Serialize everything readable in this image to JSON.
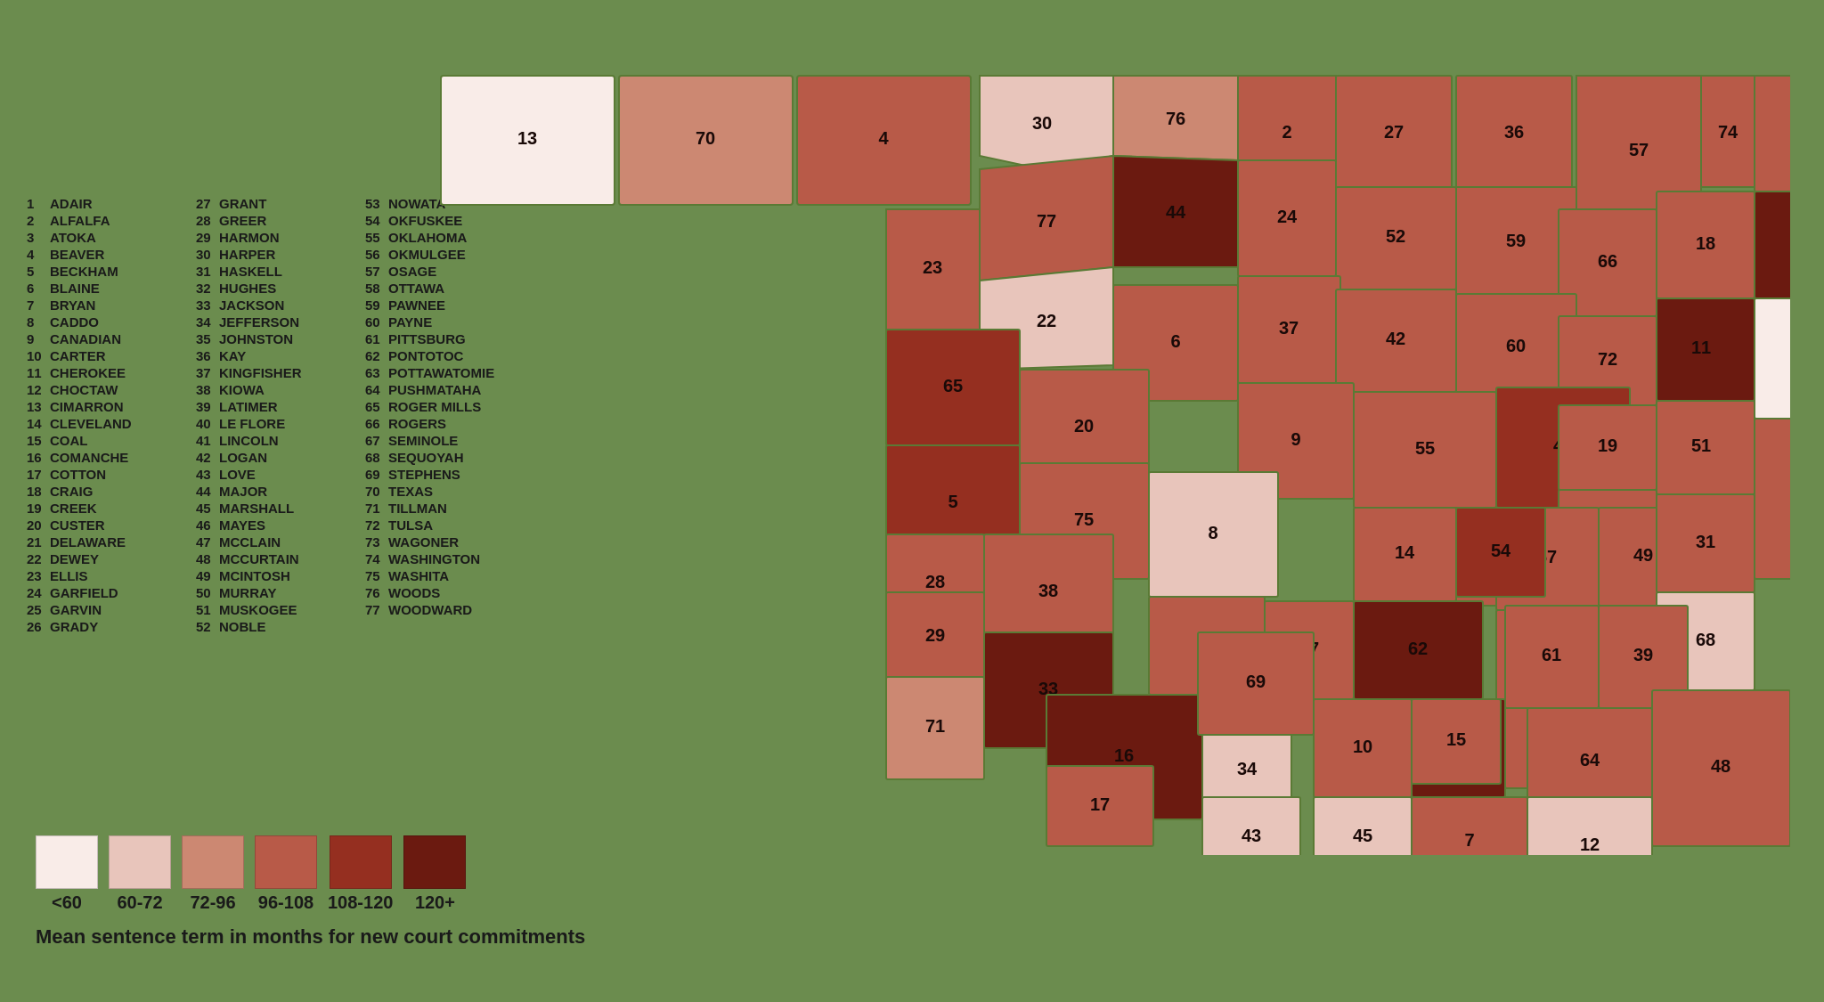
{
  "title": "Mean sentence term in months for new court commitments",
  "legend": {
    "items": [
      {
        "label": "<60",
        "color": "#f9ece8"
      },
      {
        "label": "60-72",
        "color": "#e8c5bb"
      },
      {
        "label": "72-96",
        "color": "#cc8872"
      },
      {
        "label": "96-108",
        "color": "#b85a48"
      },
      {
        "label": "108-120",
        "color": "#952f20"
      },
      {
        "label": "120+",
        "color": "#6b1a10"
      }
    ]
  },
  "counties": [
    {
      "num": 1,
      "name": "ADAIR"
    },
    {
      "num": 2,
      "name": "ALFALFA"
    },
    {
      "num": 3,
      "name": "ATOKA"
    },
    {
      "num": 4,
      "name": "BEAVER"
    },
    {
      "num": 5,
      "name": "BECKHAM"
    },
    {
      "num": 6,
      "name": "BLAINE"
    },
    {
      "num": 7,
      "name": "BRYAN"
    },
    {
      "num": 8,
      "name": "CADDO"
    },
    {
      "num": 9,
      "name": "CANADIAN"
    },
    {
      "num": 10,
      "name": "CARTER"
    },
    {
      "num": 11,
      "name": "CHEROKEE"
    },
    {
      "num": 12,
      "name": "CHOCTAW"
    },
    {
      "num": 13,
      "name": "CIMARRON"
    },
    {
      "num": 14,
      "name": "CLEVELAND"
    },
    {
      "num": 15,
      "name": "COAL"
    },
    {
      "num": 16,
      "name": "COMANCHE"
    },
    {
      "num": 17,
      "name": "COTTON"
    },
    {
      "num": 18,
      "name": "CRAIG"
    },
    {
      "num": 19,
      "name": "CREEK"
    },
    {
      "num": 20,
      "name": "CUSTER"
    },
    {
      "num": 21,
      "name": "DELAWARE"
    },
    {
      "num": 22,
      "name": "DEWEY"
    },
    {
      "num": 23,
      "name": "ELLIS"
    },
    {
      "num": 24,
      "name": "GARFIELD"
    },
    {
      "num": 25,
      "name": "GARVIN"
    },
    {
      "num": 26,
      "name": "GRADY"
    },
    {
      "num": 27,
      "name": "GRANT"
    },
    {
      "num": 28,
      "name": "GREER"
    },
    {
      "num": 29,
      "name": "HARMON"
    },
    {
      "num": 30,
      "name": "HARPER"
    },
    {
      "num": 31,
      "name": "HASKELL"
    },
    {
      "num": 32,
      "name": "HUGHES"
    },
    {
      "num": 33,
      "name": "JACKSON"
    },
    {
      "num": 34,
      "name": "JEFFERSON"
    },
    {
      "num": 35,
      "name": "JOHNSTON"
    },
    {
      "num": 36,
      "name": "KAY"
    },
    {
      "num": 37,
      "name": "KINGFISHER"
    },
    {
      "num": 38,
      "name": "KIOWA"
    },
    {
      "num": 39,
      "name": "LATIMER"
    },
    {
      "num": 40,
      "name": "LE FLORE"
    },
    {
      "num": 41,
      "name": "LINCOLN"
    },
    {
      "num": 42,
      "name": "LOGAN"
    },
    {
      "num": 43,
      "name": "LOVE"
    },
    {
      "num": 44,
      "name": "MAJOR"
    },
    {
      "num": 45,
      "name": "MARSHALL"
    },
    {
      "num": 46,
      "name": "MAYES"
    },
    {
      "num": 47,
      "name": "MCCLAIN"
    },
    {
      "num": 48,
      "name": "MCCURTAIN"
    },
    {
      "num": 49,
      "name": "MCINTOSH"
    },
    {
      "num": 50,
      "name": "MURRAY"
    },
    {
      "num": 51,
      "name": "MUSKOGEE"
    },
    {
      "num": 52,
      "name": "NOBLE"
    },
    {
      "num": 53,
      "name": "NOWATA"
    },
    {
      "num": 54,
      "name": "OKFUSKEE"
    },
    {
      "num": 55,
      "name": "OKLAHOMA"
    },
    {
      "num": 56,
      "name": "OKMULGEE"
    },
    {
      "num": 57,
      "name": "OSAGE"
    },
    {
      "num": 58,
      "name": "OTTAWA"
    },
    {
      "num": 59,
      "name": "PAWNEE"
    },
    {
      "num": 60,
      "name": "PAYNE"
    },
    {
      "num": 61,
      "name": "PITTSBURG"
    },
    {
      "num": 62,
      "name": "PONTOTOC"
    },
    {
      "num": 63,
      "name": "POTTAWATOMIE"
    },
    {
      "num": 64,
      "name": "PUSHMATAHA"
    },
    {
      "num": 65,
      "name": "ROGER MILLS"
    },
    {
      "num": 66,
      "name": "ROGERS"
    },
    {
      "num": 67,
      "name": "SEMINOLE"
    },
    {
      "num": 68,
      "name": "SEQUOYAH"
    },
    {
      "num": 69,
      "name": "STEPHENS"
    },
    {
      "num": 70,
      "name": "TEXAS"
    },
    {
      "num": 71,
      "name": "TILLMAN"
    },
    {
      "num": 72,
      "name": "TULSA"
    },
    {
      "num": 73,
      "name": "WAGONER"
    },
    {
      "num": 74,
      "name": "WASHINGTON"
    },
    {
      "num": 75,
      "name": "WASHITA"
    },
    {
      "num": 76,
      "name": "WOODS"
    },
    {
      "num": 77,
      "name": "WOODWARD"
    }
  ]
}
